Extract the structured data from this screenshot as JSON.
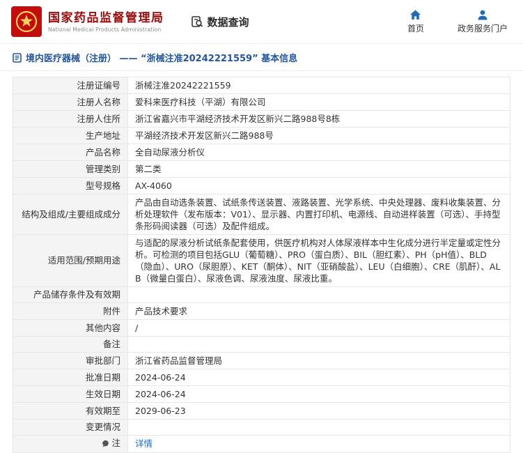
{
  "colors": {
    "brand_red": "#c30d0d",
    "org_title_red": "#9c0b0b",
    "icon_blue": "#1e6bb8",
    "title_blue": "#24569e",
    "link_blue": "#1a6fd1",
    "label_cell_bg": "#f4f4f4"
  },
  "header": {
    "org_name_cn": "国家药品监督管理局",
    "org_name_en": "National Medical Products Administration",
    "data_query_label": "数据查询",
    "home_label": "首页",
    "portal_label": "政务服务门户"
  },
  "breadcrumb": {
    "text": "境内医疗器械（注册） —— “浙械注准20242221559” 基本信息"
  },
  "table": {
    "rows": [
      {
        "label": "注册证编号",
        "value": "浙械注准20242221559"
      },
      {
        "label": "注册人名称",
        "value": "爱科来医疗科技（平湖）有限公司"
      },
      {
        "label": "注册人住所",
        "value": "浙江省嘉兴市平湖经济技术开发区新兴二路988号8栋"
      },
      {
        "label": "生产地址",
        "value": "平湖经济技术开发区新兴二路988号"
      },
      {
        "label": "产品名称",
        "value": "全自动尿液分析仪"
      },
      {
        "label": "管理类别",
        "value": "第二类"
      },
      {
        "label": "型号规格",
        "value": "AX-4060"
      },
      {
        "label": "结构及组成/主要组成成分",
        "value": "产品由自动选条装置、试纸条传送装置、液路装置、光学系统、中央处理器、废料收集装置、分析处理软件（发布版本：V01）、显示器、内置打印机、电源线、自动进样装置（可选）、手持型条形码阅读器（可选）及配件组成。"
      },
      {
        "label": "适用范围/预期用途",
        "value": "与适配的尿液分析试纸条配套使用，供医疗机构对人体尿液样本中生化成分进行半定量或定性分析。可检测的项目包括GLU（葡萄糖）、PRO（蛋白质）、BIL（胆红素）、PH（pH值）、BLD（隐血）、URO（尿胆原）、KET（酮体）、NIT（亚硝酸盐）、LEU（白细胞）、CRE（肌酐）、ALB（微量白蛋白）、尿液色调、尿液浊度、尿液比重。"
      },
      {
        "label": "产品储存条件及有效期",
        "value": ""
      },
      {
        "label": "附件",
        "value": "产品技术要求"
      },
      {
        "label": "其他内容",
        "value": "/"
      },
      {
        "label": "备注",
        "value": ""
      },
      {
        "label": "审批部门",
        "value": "浙江省药品监督管理局"
      },
      {
        "label": "批准日期",
        "value": "2024-06-24"
      },
      {
        "label": "生效日期",
        "value": "2024-06-24"
      },
      {
        "label": "有效期至",
        "value": "2029-06-23"
      },
      {
        "label": "变更情况",
        "value": ""
      },
      {
        "label": "注",
        "value": "详情"
      }
    ]
  }
}
